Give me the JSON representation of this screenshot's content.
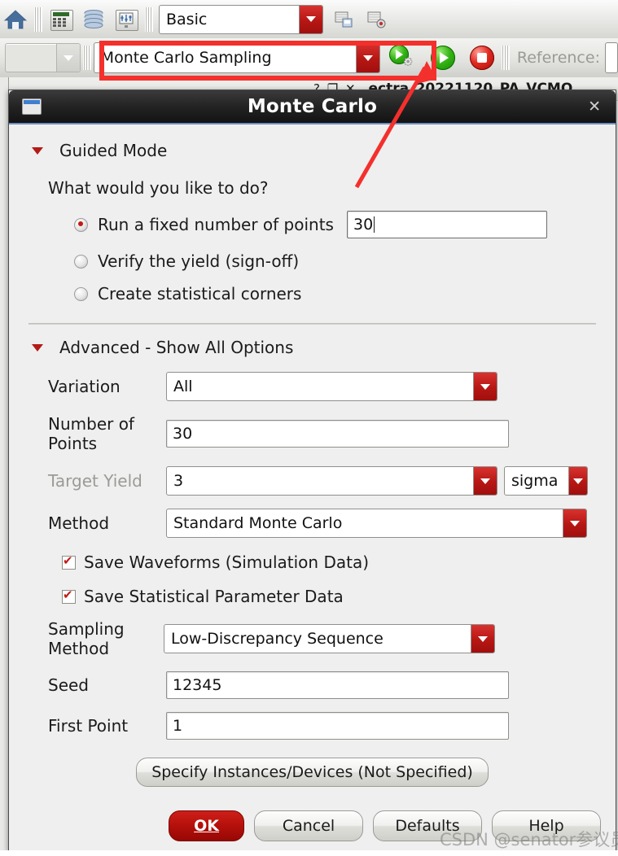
{
  "toolbar1": {
    "icons": [
      "home-icon",
      "calculator-icon",
      "database-icon",
      "schematic-icon"
    ],
    "combo_value": "Basic",
    "right_icons": [
      "save-session-icon",
      "load-session-icon"
    ]
  },
  "toolbar2": {
    "combo_value": "Monte Carlo Sampling",
    "gear_run_icon": "run-with-options-icon",
    "play_icon": "run-simulation-icon",
    "stop_icon": "stop-simulation-icon",
    "reference_label": "Reference:"
  },
  "background_window": {
    "tiny_buttons": "? ❐ ✕",
    "title_fragment": "ectra_20221120_PA_VCMO"
  },
  "dialog": {
    "title": "Monte Carlo",
    "close_label": "✕",
    "window_icon": "window-icon",
    "guided": {
      "header": "Guided Mode",
      "question": "What would you like to do?",
      "options": [
        {
          "label": "Run a fixed number of points",
          "selected": true
        },
        {
          "label": "Verify the yield (sign-off)",
          "selected": false
        },
        {
          "label": "Create statistical corners",
          "selected": false
        }
      ],
      "points_value": "30"
    },
    "advanced": {
      "header": "Advanced - Show All Options",
      "fields": [
        {
          "label": "Variation",
          "value": "All",
          "type": "combo",
          "disabled": false
        },
        {
          "label": "Number of Points",
          "value": "30",
          "type": "text",
          "disabled": false
        },
        {
          "label": "Target Yield",
          "value": "3",
          "type": "combo",
          "disabled": true,
          "unit": "sigma"
        },
        {
          "label": "Method",
          "value": "Standard Monte Carlo",
          "type": "combo",
          "disabled": false
        },
        {
          "label": "Sampling Method",
          "value": "Low-Discrepancy Sequence",
          "type": "combo",
          "disabled": false
        },
        {
          "label": "Seed",
          "value": "12345",
          "type": "text",
          "disabled": false
        },
        {
          "label": "First Point",
          "value": "1",
          "type": "text",
          "disabled": false
        }
      ],
      "checkboxes": [
        {
          "label": "Save Waveforms (Simulation Data)",
          "checked": true
        },
        {
          "label": "Save Statistical Parameter Data",
          "checked": true
        }
      ],
      "specify_button": "Specify Instances/Devices (Not Specified)"
    },
    "buttons": {
      "ok": "OK",
      "cancel": "Cancel",
      "defaults": "Defaults",
      "help": "Help"
    }
  },
  "annotation": {
    "highlight_color": "#f4302c",
    "arrow_color": "#f4302c"
  },
  "watermark": "CSDN @senator参议员",
  "colors": {
    "accent_red": "#b4100b",
    "titlebar": "#1e1e1e",
    "dialog_bg": "#efefef"
  }
}
